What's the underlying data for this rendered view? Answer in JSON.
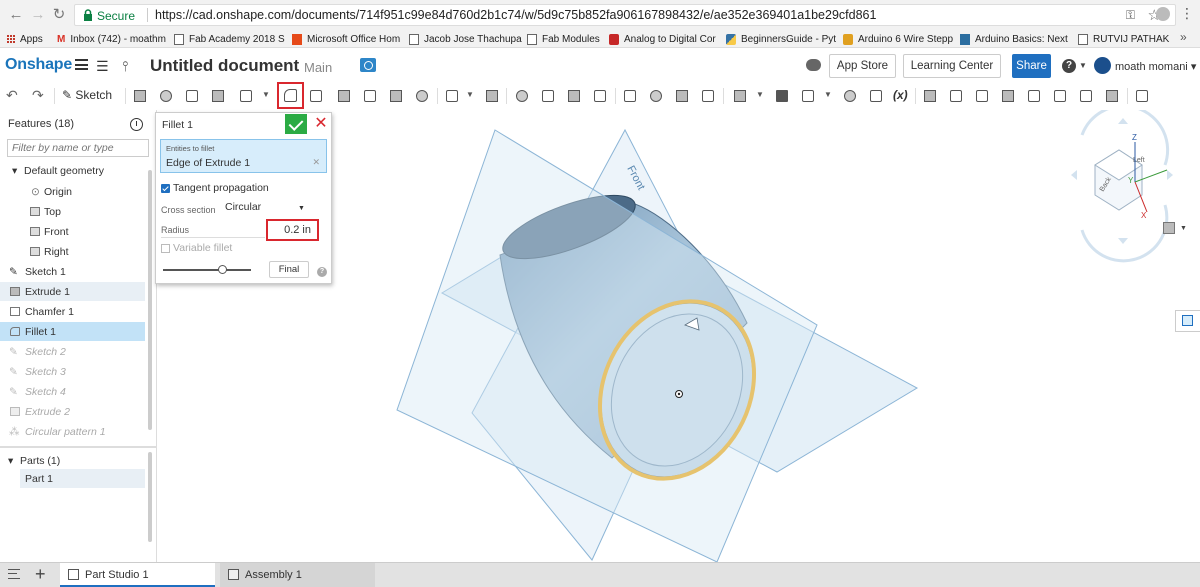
{
  "browser": {
    "secure_label": "Secure",
    "url": "https://cad.onshape.com/documents/714f951c99e84d760d2b1c74/w/5d9c75b852fa906167898432/e/ae352e369401a1be29cfd861",
    "bookmarks": [
      {
        "label": "Apps"
      },
      {
        "label": "Inbox (742) - moathm"
      },
      {
        "label": "Fab Academy 2018 S"
      },
      {
        "label": "Microsoft Office Hom"
      },
      {
        "label": "Jacob Jose Thachupa"
      },
      {
        "label": "Fab Modules"
      },
      {
        "label": "Analog to Digital Cor"
      },
      {
        "label": "BeginnersGuide - Pyt"
      },
      {
        "label": "Arduino 6 Wire Stepp"
      },
      {
        "label": "Arduino Basics: Next"
      },
      {
        "label": "RUTVIJ PATHAK"
      }
    ]
  },
  "header": {
    "logo": "Onshape",
    "doc_title": "Untitled document",
    "workspace": "Main",
    "app_store": "App Store",
    "learning_center": "Learning Center",
    "share": "Share",
    "user": "moath momani",
    "help": "?",
    "brand_color": "#1b75bb"
  },
  "toolbar": {
    "sketch_label": "Sketch",
    "variable_label": "(x)"
  },
  "features": {
    "title": "Features (18)",
    "filter_placeholder": "Filter by name or type",
    "items": [
      {
        "label": "Default geometry",
        "state": "group"
      },
      {
        "label": "Origin",
        "state": "normal"
      },
      {
        "label": "Top",
        "state": "normal"
      },
      {
        "label": "Front",
        "state": "normal"
      },
      {
        "label": "Right",
        "state": "normal"
      },
      {
        "label": "Sketch 1",
        "state": "normal"
      },
      {
        "label": "Extrude 1",
        "state": "hover"
      },
      {
        "label": "Chamfer 1",
        "state": "normal"
      },
      {
        "label": "Fillet 1",
        "state": "selected"
      },
      {
        "label": "Sketch 2",
        "state": "suppressed"
      },
      {
        "label": "Sketch 3",
        "state": "suppressed"
      },
      {
        "label": "Sketch 4",
        "state": "suppressed"
      },
      {
        "label": "Extrude 2",
        "state": "suppressed"
      },
      {
        "label": "Circular pattern 1",
        "state": "suppressed"
      }
    ],
    "parts_title": "Parts (1)",
    "parts": [
      "Part 1"
    ]
  },
  "dialog": {
    "title": "Fillet 1",
    "entities_label": "Entities to fillet",
    "entities_value": "Edge of Extrude 1",
    "tangent_label": "Tangent propagation",
    "tangent_checked": true,
    "cross_section_label": "Cross section",
    "cross_section_value": "Circular",
    "radius_label": "Radius",
    "radius_value": "0.2 in",
    "variable_label": "Variable fillet",
    "variable_checked": false,
    "final_label": "Final",
    "highlight_color": "#d9272e"
  },
  "viewport": {
    "plane_label": "Front",
    "cube": {
      "face_left": "Left",
      "face_back": "Back",
      "axis_x": "X",
      "axis_y": "Y",
      "axis_z": "Z"
    },
    "edge_highlight_color": "#f2a400",
    "part_color": "#8fb2cf"
  },
  "tabs": [
    {
      "label": "Part Studio 1",
      "active": true
    },
    {
      "label": "Assembly 1",
      "active": false
    }
  ]
}
